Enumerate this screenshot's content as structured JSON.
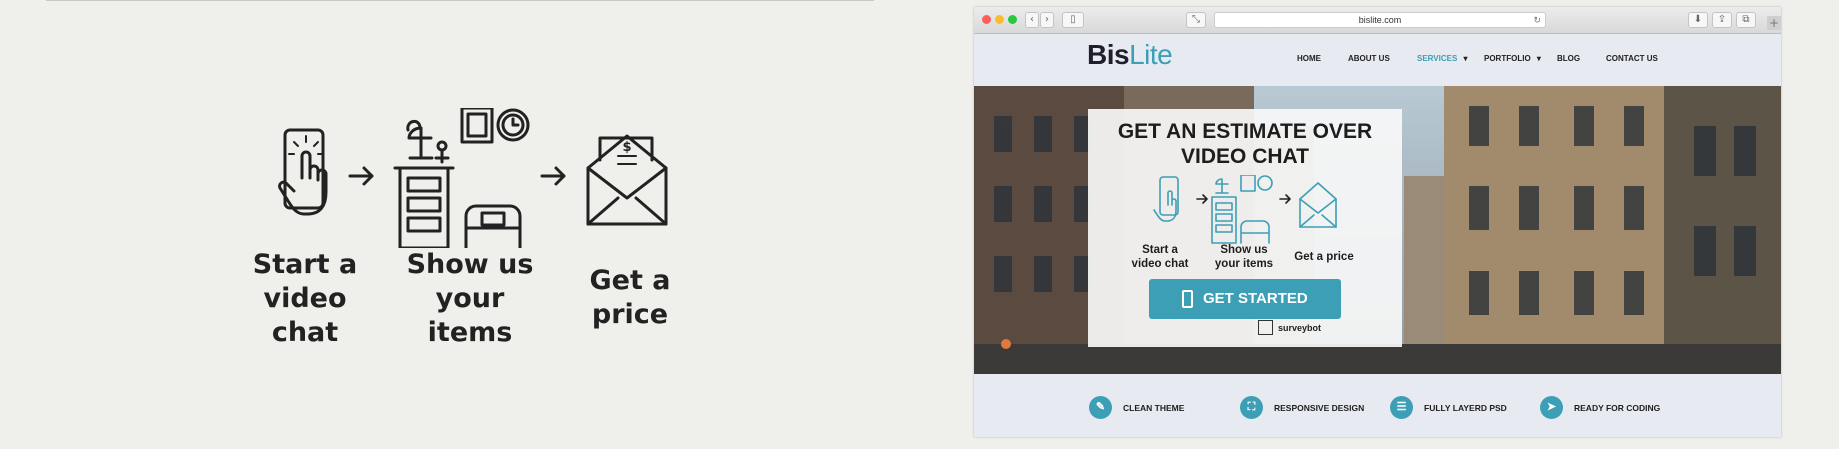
{
  "illustration": {
    "steps": [
      {
        "line1": "Start a",
        "line2": "video chat"
      },
      {
        "line1": "Show us",
        "line2": "your items"
      },
      {
        "line1": "Get a price",
        "line2": ""
      }
    ]
  },
  "browser": {
    "url": "bislite.com",
    "site": {
      "logo_part1": "Bis",
      "logo_part2": "Lite",
      "nav": [
        "HOME",
        "ABOUT US",
        "SERVICES",
        "PORTFOLIO",
        "BLOG",
        "CONTACT US"
      ],
      "active_nav": "SERVICES",
      "nav_dropdown_marker": "▾",
      "widget": {
        "title_line1": "GET AN ESTIMATE OVER",
        "title_line2": "VIDEO CHAT",
        "steps": [
          {
            "line1": "Start a",
            "line2": "video chat"
          },
          {
            "line1": "Show us",
            "line2": "your items"
          },
          {
            "line1": "Get a price",
            "line2": ""
          }
        ],
        "cta_label": "GET STARTED",
        "brand": "surveybot"
      },
      "features": [
        "CLEAN THEME",
        "RESPONSIVE DESIGN",
        "FULLY LAYERD PSD",
        "READY FOR CODING"
      ]
    },
    "colors": {
      "accent": "#3c9fb6",
      "dark": "#1f1f2b"
    }
  }
}
